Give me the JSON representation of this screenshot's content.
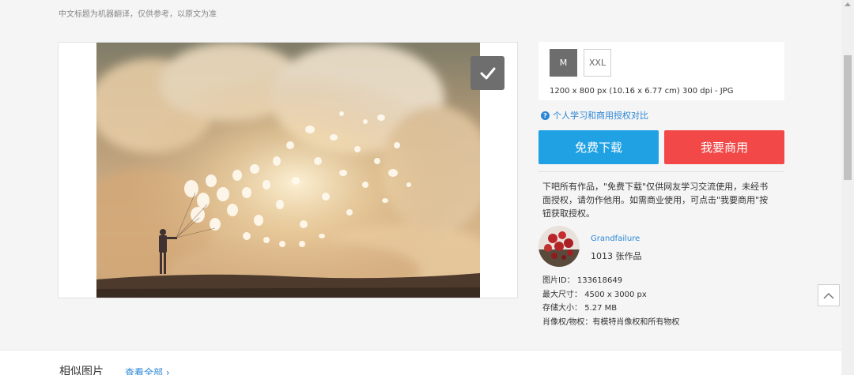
{
  "top_note": "中文标题为机器翻译，仅供参考，以原文为准",
  "sizes": {
    "options": [
      "M",
      "XXL"
    ],
    "selected": "M",
    "spec": "1200 x 800 px (10.16 x 6.77 cm) 300 dpi - JPG"
  },
  "license_link": {
    "label": "个人学习和商用授权对比",
    "icon": "question-circle-icon"
  },
  "buttons": {
    "free_download": "免费下载",
    "commercial": "我要商用"
  },
  "notice": "下吧所有作品，\"免费下载\"仅供网友学习交流使用，未经书面授权，请勿作他用。如需商业使用，可点击\"我要商用\"按钮获取授权。",
  "author": {
    "name": "Grandfailure",
    "works": "1013 张作品"
  },
  "meta": {
    "image_id_label": "图片ID：",
    "image_id": "133618649",
    "max_size_label": "最大尺寸：",
    "max_size": "4500 x 3000 px",
    "storage_label": "存储大小：",
    "storage": "5.27 MB",
    "rights": "肖像权/物权：有模特肖像权和所有物权"
  },
  "similar": {
    "title": "相似图片",
    "view_all": "查看全部 ›"
  },
  "colors": {
    "accent_blue": "#1fa1e3",
    "accent_red": "#f24848",
    "link_blue": "#2b86d5"
  }
}
